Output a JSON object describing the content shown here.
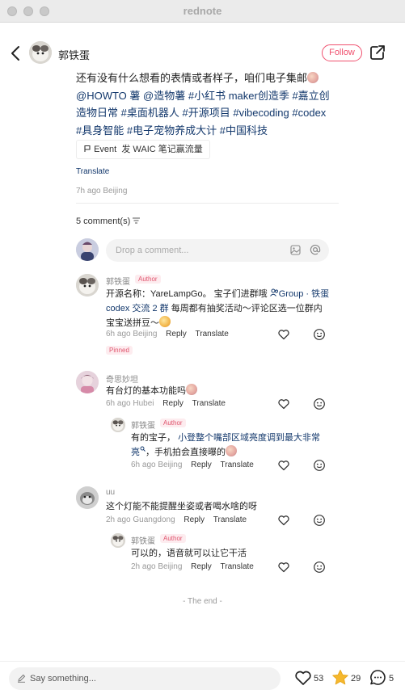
{
  "window": {
    "title": "rednote"
  },
  "header": {
    "author_name": "郭铁蛋",
    "follow_label": "Follow"
  },
  "post": {
    "text_1": "还有没有什么想看的表情或者样子，咱们电子集邮",
    "tags_line": [
      "@HOWTO 薯",
      "@造物薯",
      "#小红书 maker创造季",
      "#嘉立创造物日常",
      "#桌面机器人",
      "#开源项目",
      "#vibecoding",
      "#codex",
      "#具身智能",
      "#电子宠物养成大计",
      "#中国科技"
    ],
    "event_label": "Event",
    "event_text": "发 WAIC 笔记赢流量",
    "translate_label": "Translate",
    "meta": "7h ago Beijing"
  },
  "comments_header": {
    "label": "5 comment(s)"
  },
  "comment_input": {
    "placeholder": "Drop a comment..."
  },
  "comments": [
    {
      "name": "郭铁蛋",
      "badge": "Author",
      "text_a": "开源名称：YareLampGo。 宝子们进群哦 ",
      "group_link": "Group · 铁蛋 codex 交流 2 群",
      "text_b": " 每周都有抽奖活动～评论区选一位群内宝宝送拼豆～",
      "time_loc": "6h ago Beijing",
      "reply_label": "Reply",
      "translate_label": "Translate",
      "pinned_label": "Pinned"
    },
    {
      "name": "奇思妙坦",
      "text": "有台灯的基本功能吗",
      "time_loc": "6h ago Hubei",
      "reply_label": "Reply",
      "translate_label": "Translate",
      "reply": {
        "name": "郭铁蛋",
        "badge": "Author",
        "text_a": "有的宝子，",
        "search_link": "小登整个嘴部区域亮度调到最大非常亮",
        "text_b": "，手机拍会直接曝的",
        "time_loc": "6h ago Beijing",
        "reply_label": "Reply",
        "translate_label": "Translate"
      }
    },
    {
      "name": "uu",
      "text": "这个灯能不能提醒坐姿或者喝水啥的呀",
      "time_loc": "2h ago Guangdong",
      "reply_label": "Reply",
      "translate_label": "Translate",
      "reply": {
        "name": "郭铁蛋",
        "badge": "Author",
        "text": "可以的，语音就可以让它干活",
        "time_loc": "2h ago Beijing",
        "reply_label": "Reply",
        "translate_label": "Translate"
      }
    }
  ],
  "end_text": "- The end -",
  "bottom_bar": {
    "placeholder": "Say something...",
    "likes": "53",
    "collects": "29",
    "comments": "5"
  },
  "colors": {
    "brand": "#f0506e",
    "tag": "#13386c",
    "star": "#f5b82e"
  },
  "icons": [
    "back-icon",
    "share-icon",
    "image-icon",
    "at-icon",
    "heart-icon",
    "smile-icon",
    "star-icon",
    "comment-icon",
    "pencil-icon",
    "filter-icon",
    "flag-icon"
  ]
}
